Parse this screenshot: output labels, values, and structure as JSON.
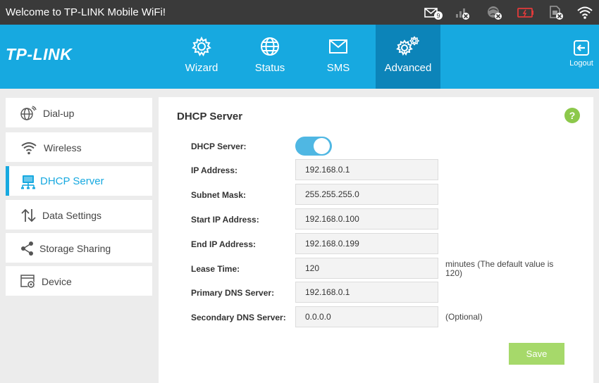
{
  "status_bar": {
    "welcome": "Welcome to TP-LINK Mobile WiFi!",
    "sms_count": "9",
    "icons": [
      "envelope-icon",
      "signal-icon",
      "globe-disconnected-icon",
      "battery-low-icon",
      "sim-icon",
      "wifi-icon"
    ]
  },
  "header": {
    "logo": "TP-LINK",
    "tabs": [
      {
        "label": "Wizard",
        "icon": "gear-icon"
      },
      {
        "label": "Status",
        "icon": "globe-icon"
      },
      {
        "label": "SMS",
        "icon": "envelope-icon"
      },
      {
        "label": "Advanced",
        "icon": "gears-icon"
      }
    ],
    "active_tab": "Advanced",
    "logout": "Logout"
  },
  "sidebar": {
    "items": [
      {
        "label": "Dial-up",
        "icon": "dialup-globe-icon"
      },
      {
        "label": "Wireless",
        "icon": "wifi-icon"
      },
      {
        "label": "DHCP Server",
        "icon": "network-icon"
      },
      {
        "label": "Data Settings",
        "icon": "updown-arrows-icon"
      },
      {
        "label": "Storage Sharing",
        "icon": "share-icon"
      },
      {
        "label": "Device",
        "icon": "device-settings-icon"
      }
    ],
    "active": "DHCP Server"
  },
  "main": {
    "title": "DHCP Server",
    "help": "?",
    "fields": {
      "dhcp_label": "DHCP Server:",
      "ip_label": "IP Address:",
      "ip_value": "192.168.0.1",
      "subnet_label": "Subnet Mask:",
      "subnet_value": "255.255.255.0",
      "start_label": "Start IP Address:",
      "start_value": "192.168.0.100",
      "end_label": "End IP Address:",
      "end_value": "192.168.0.199",
      "lease_label": "Lease Time:",
      "lease_value": "120",
      "lease_note_1": "minutes (The default value is",
      "lease_note_2": "120)",
      "pdns_label": "Primary DNS Server:",
      "pdns_value": "192.168.0.1",
      "sdns_label": "Secondary DNS Server:",
      "sdns_value": "0.0.0.0",
      "sdns_note": "(Optional)"
    },
    "dhcp_enabled": true,
    "save": "Save"
  },
  "colors": {
    "header": "#17a9e0",
    "active_tab": "#0c84b9",
    "status_bar": "#3a3a3a",
    "save": "#a6d96a",
    "help": "#8cc84b"
  }
}
